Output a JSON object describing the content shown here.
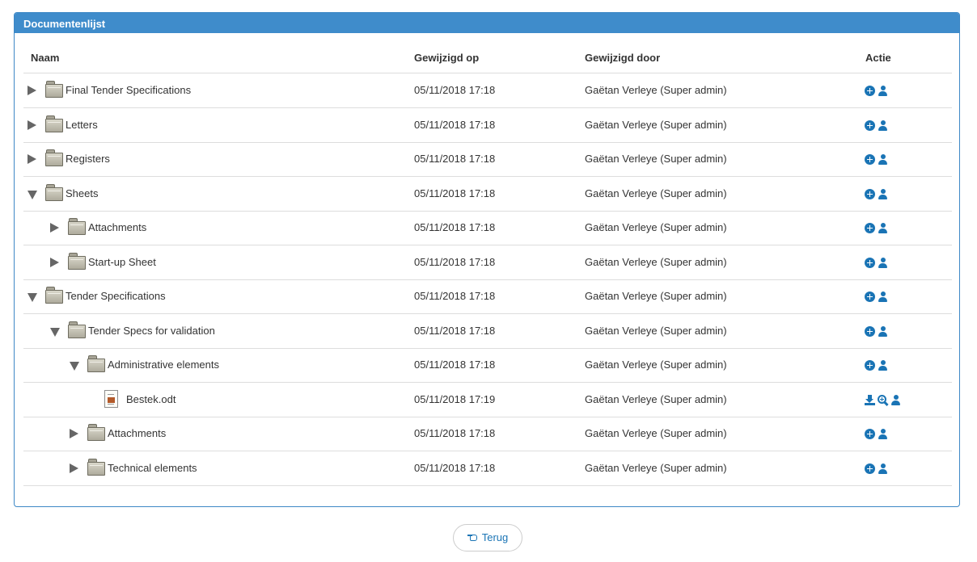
{
  "panel": {
    "title": "Documentenlijst"
  },
  "columns": {
    "name": "Naam",
    "modified_on": "Gewijzigd op",
    "modified_by": "Gewijzigd door",
    "action": "Actie"
  },
  "rows": [
    {
      "name": "Final Tender Specifications",
      "date": "05/11/2018 17:18",
      "by": "Gaëtan Verleye (Super admin)",
      "type": "folder",
      "state": "collapsed",
      "depth": 0
    },
    {
      "name": "Letters",
      "date": "05/11/2018 17:18",
      "by": "Gaëtan Verleye (Super admin)",
      "type": "folder",
      "state": "collapsed",
      "depth": 0
    },
    {
      "name": "Registers",
      "date": "05/11/2018 17:18",
      "by": "Gaëtan Verleye (Super admin)",
      "type": "folder",
      "state": "collapsed",
      "depth": 0
    },
    {
      "name": "Sheets",
      "date": "05/11/2018 17:18",
      "by": "Gaëtan Verleye (Super admin)",
      "type": "folder",
      "state": "expanded",
      "depth": 0
    },
    {
      "name": "Attachments",
      "date": "05/11/2018 17:18",
      "by": "Gaëtan Verleye (Super admin)",
      "type": "folder",
      "state": "collapsed",
      "depth": 1
    },
    {
      "name": "Start-up Sheet",
      "date": "05/11/2018 17:18",
      "by": "Gaëtan Verleye (Super admin)",
      "type": "folder",
      "state": "collapsed",
      "depth": 1
    },
    {
      "name": "Tender Specifications",
      "date": "05/11/2018 17:18",
      "by": "Gaëtan Verleye (Super admin)",
      "type": "folder",
      "state": "expanded",
      "depth": 0
    },
    {
      "name": "Tender Specs for validation",
      "date": "05/11/2018 17:18",
      "by": "Gaëtan Verleye (Super admin)",
      "type": "folder",
      "state": "expanded",
      "depth": 1
    },
    {
      "name": "Administrative elements",
      "date": "05/11/2018 17:18",
      "by": "Gaëtan Verleye (Super admin)",
      "type": "folder",
      "state": "expanded",
      "depth": 2
    },
    {
      "name": "Bestek.odt",
      "date": "05/11/2018 17:19",
      "by": "Gaëtan Verleye (Super admin)",
      "type": "file",
      "state": "none",
      "depth": 3
    },
    {
      "name": "Attachments",
      "date": "05/11/2018 17:18",
      "by": "Gaëtan Verleye (Super admin)",
      "type": "folder",
      "state": "collapsed",
      "depth": 2
    },
    {
      "name": "Technical elements",
      "date": "05/11/2018 17:18",
      "by": "Gaëtan Verleye (Super admin)",
      "type": "folder",
      "state": "collapsed",
      "depth": 2
    }
  ],
  "actions": {
    "folder": [
      "add-circle-icon",
      "user-icon"
    ],
    "file": [
      "download-icon",
      "zoom-in-icon",
      "user-icon"
    ]
  },
  "footer": {
    "back_label": "Terug",
    "back_icon": "hand-pointer-icon"
  },
  "colors": {
    "header_bg": "#3f8ccb",
    "accent": "#1a74b5"
  }
}
